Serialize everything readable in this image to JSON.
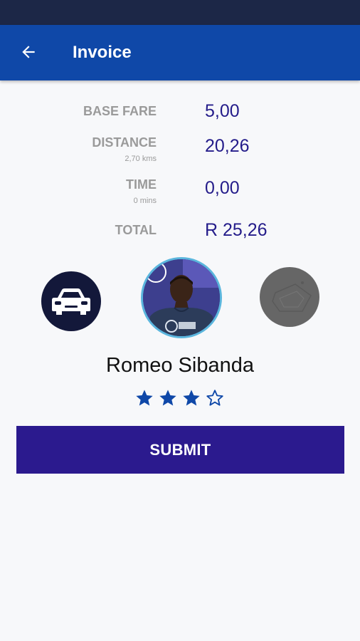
{
  "header": {
    "title": "Invoice",
    "back_icon": "arrow-left-icon"
  },
  "invoice": {
    "base_fare": {
      "label": "BASE FARE",
      "value": "5,00"
    },
    "distance": {
      "label": "DISTANCE",
      "sub": "2,70 kms",
      "value": "20,26"
    },
    "time": {
      "label": "TIME",
      "sub": "0 mins",
      "value": "0,00"
    },
    "total": {
      "label": "TOTAL",
      "value": "R 25,26"
    }
  },
  "driver": {
    "name": "Romeo Sibanda",
    "rating": 3,
    "max_rating": 5
  },
  "icons": {
    "car": "car-icon",
    "map": "map-icon",
    "star_filled": "star-filled-icon",
    "star_outline": "star-outline-icon"
  },
  "actions": {
    "submit_label": "SUBMIT"
  },
  "colors": {
    "status_bar": "#1c2747",
    "app_bar": "#0f48a8",
    "value_text": "#241c8a",
    "label_text": "#9a9a9a",
    "submit_bg": "#2b1a8e",
    "star": "#0f48a8"
  }
}
